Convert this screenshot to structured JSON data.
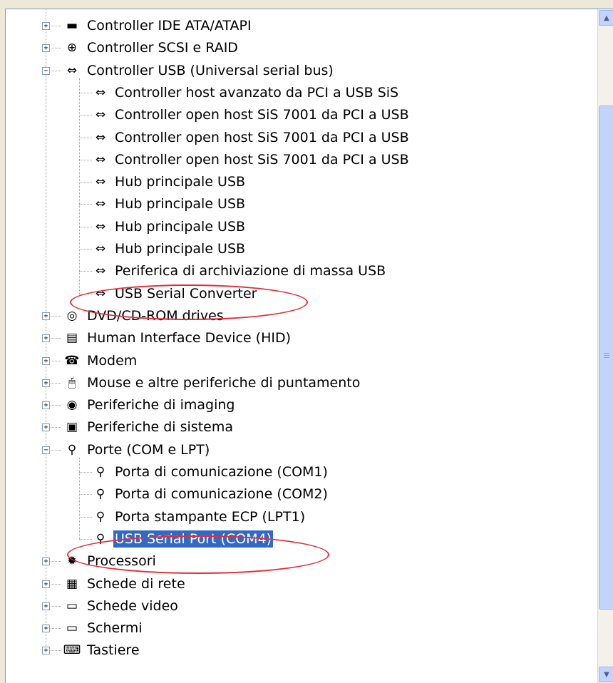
{
  "tree": {
    "rows": [
      {
        "label": "Controller IDE ATA/ATAPI",
        "icon": "ide-controller-icon",
        "glyph": "▬",
        "level": 0,
        "expander": "+"
      },
      {
        "label": "Controller SCSI e RAID",
        "icon": "scsi-controller-icon",
        "glyph": "⊕",
        "level": 0,
        "expander": "+"
      },
      {
        "label": "Controller USB (Universal serial bus)",
        "icon": "usb-icon",
        "glyph": "⇔",
        "level": 0,
        "expander": "−"
      },
      {
        "label": "Controller host avanzato da PCI a USB SiS",
        "icon": "usb-icon",
        "glyph": "⇔",
        "level": 1
      },
      {
        "label": "Controller open host SiS 7001 da PCI a USB",
        "icon": "usb-icon",
        "glyph": "⇔",
        "level": 1
      },
      {
        "label": "Controller open host SiS 7001 da PCI a USB",
        "icon": "usb-icon",
        "glyph": "⇔",
        "level": 1
      },
      {
        "label": "Controller open host SiS 7001 da PCI a USB",
        "icon": "usb-icon",
        "glyph": "⇔",
        "level": 1
      },
      {
        "label": "Hub principale USB",
        "icon": "usb-icon",
        "glyph": "⇔",
        "level": 1
      },
      {
        "label": "Hub principale USB",
        "icon": "usb-icon",
        "glyph": "⇔",
        "level": 1
      },
      {
        "label": "Hub principale USB",
        "icon": "usb-icon",
        "glyph": "⇔",
        "level": 1
      },
      {
        "label": "Hub principale USB",
        "icon": "usb-icon",
        "glyph": "⇔",
        "level": 1
      },
      {
        "label": "Periferica di archiviazione di massa USB",
        "icon": "usb-icon",
        "glyph": "⇔",
        "level": 1
      },
      {
        "label": "USB Serial Converter",
        "icon": "usb-icon",
        "glyph": "⇔",
        "level": 1
      },
      {
        "label": "DVD/CD-ROM drives",
        "icon": "cd-drive-icon",
        "glyph": "◎",
        "level": 0,
        "expander": "+"
      },
      {
        "label": "Human Interface Device (HID)",
        "icon": "hid-icon",
        "glyph": "▤",
        "level": 0,
        "expander": "+"
      },
      {
        "label": "Modem",
        "icon": "modem-icon",
        "glyph": "☎",
        "level": 0,
        "expander": "+"
      },
      {
        "label": "Mouse e altre periferiche di puntamento",
        "icon": "mouse-icon",
        "glyph": "🖱",
        "level": 0,
        "expander": "+"
      },
      {
        "label": "Periferiche di imaging",
        "icon": "camera-icon",
        "glyph": "◉",
        "level": 0,
        "expander": "+"
      },
      {
        "label": "Periferiche di sistema",
        "icon": "computer-icon",
        "glyph": "▣",
        "level": 0,
        "expander": "+"
      },
      {
        "label": "Porte (COM e LPT)",
        "icon": "port-connector-icon",
        "glyph": "⚲",
        "level": 0,
        "expander": "−"
      },
      {
        "label": "Porta di comunicazione (COM1)",
        "icon": "port-connector-icon",
        "glyph": "⚲",
        "level": 1
      },
      {
        "label": "Porta di comunicazione (COM2)",
        "icon": "port-connector-icon",
        "glyph": "⚲",
        "level": 1
      },
      {
        "label": "Porta stampante ECP (LPT1)",
        "icon": "port-connector-icon",
        "glyph": "⚲",
        "level": 1
      },
      {
        "label": "USB Serial Port (COM4)",
        "icon": "port-connector-icon",
        "glyph": "⚲",
        "level": 1,
        "selected": true
      },
      {
        "label": "Processori",
        "icon": "processor-icon",
        "glyph": "✹",
        "level": 0,
        "expander": "+"
      },
      {
        "label": "Schede di rete",
        "icon": "network-card-icon",
        "glyph": "▦",
        "level": 0,
        "expander": "+"
      },
      {
        "label": "Schede video",
        "icon": "monitor-icon",
        "glyph": "▭",
        "level": 0,
        "expander": "+"
      },
      {
        "label": "Schermi",
        "icon": "monitor-icon",
        "glyph": "▭",
        "level": 0,
        "expander": "+"
      },
      {
        "label": "Tastiere",
        "icon": "keyboard-icon",
        "glyph": "⌨",
        "level": 0,
        "expander": "+"
      }
    ]
  },
  "scrollbar": {
    "up_glyph": "▲",
    "down_glyph": "▼"
  },
  "colors": {
    "selection": "#316ac5",
    "highlight_ellipse": "#e32d3a"
  }
}
